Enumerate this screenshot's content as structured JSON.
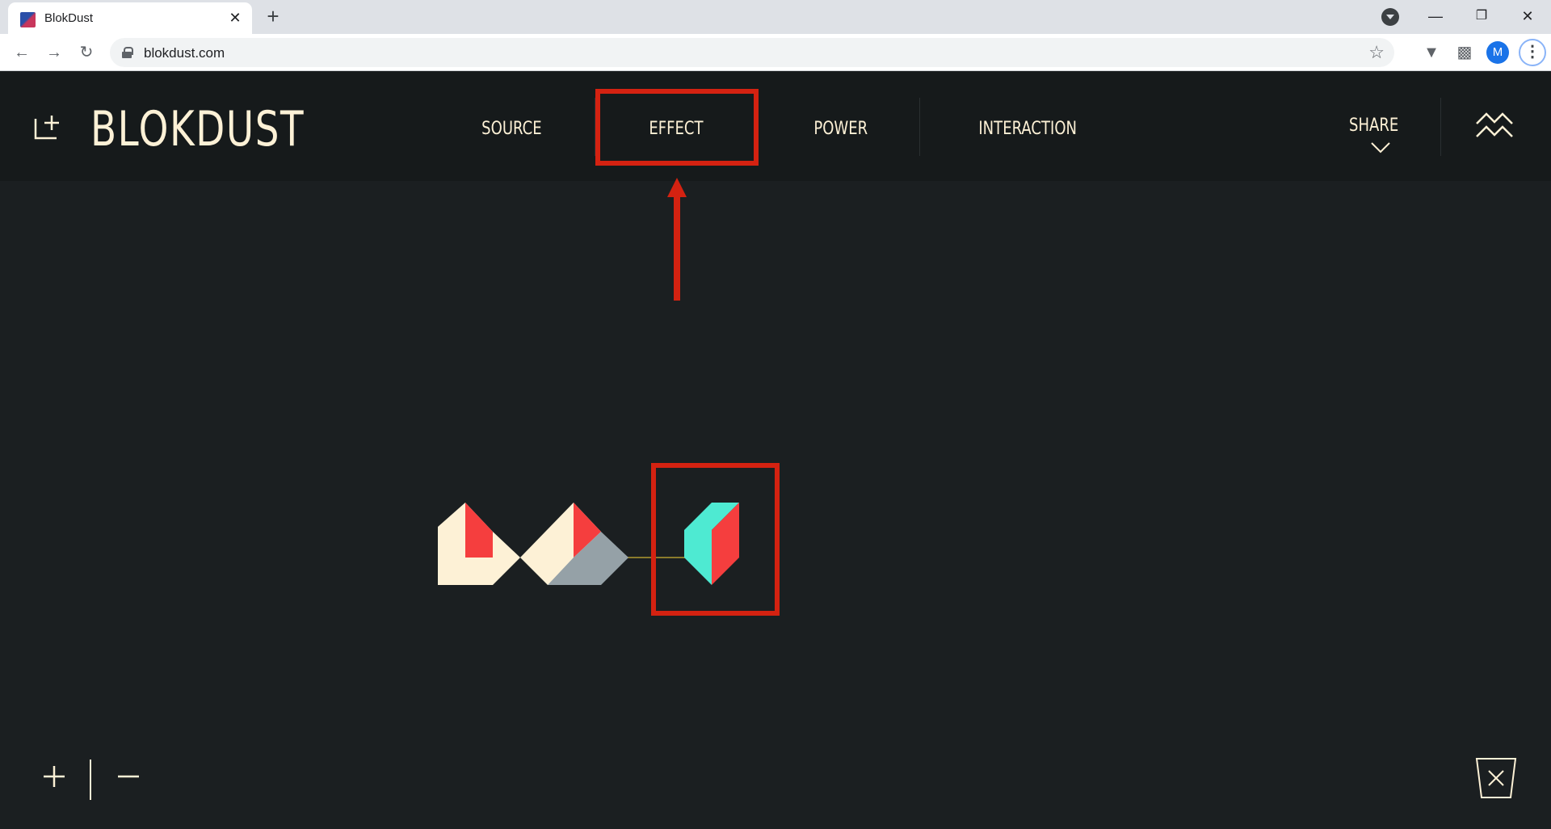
{
  "browser": {
    "tab_title": "BlokDust",
    "tab_close_icon": "close-icon",
    "new_tab_icon": "plus-icon",
    "url": "blokdust.com",
    "window_controls": [
      "minimize-icon",
      "restore-icon",
      "close-icon"
    ],
    "avatar_letter": "M"
  },
  "app": {
    "logo": "BLOKDUST",
    "nav": {
      "source": "SOURCE",
      "effect": "EFFECT",
      "power": "POWER",
      "interaction": "INTERACTION"
    },
    "share": "SHARE",
    "colors": {
      "background": "#1b1f21",
      "header": "#161a1b",
      "cream": "#fdf1d6",
      "red": "#f53e3e",
      "grey": "#95a1a7",
      "teal": "#4eead2",
      "highlight": "#d42211",
      "connector": "#8a7a2c"
    },
    "canvas_blocks": [
      "source-block",
      "source-block",
      "effect-block"
    ]
  }
}
